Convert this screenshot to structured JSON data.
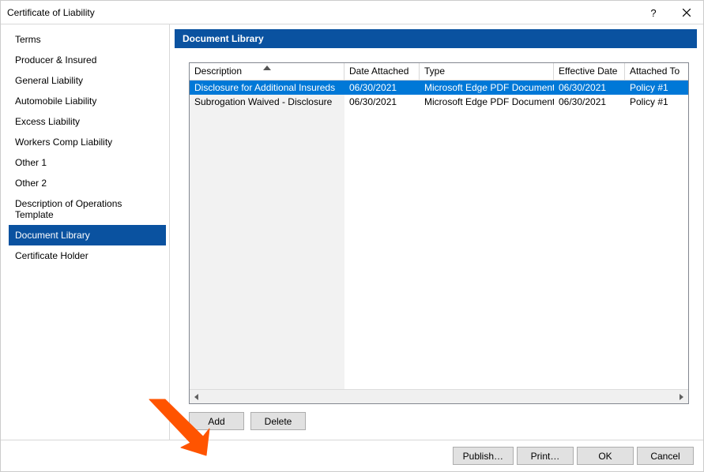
{
  "window": {
    "title": "Certificate of Liability"
  },
  "sidebar": {
    "items": [
      "Terms",
      "Producer & Insured",
      "General Liability",
      "Automobile Liability",
      "Excess Liability",
      "Workers Comp Liability",
      "Other 1",
      "Other 2",
      "Description of Operations Template",
      "Document Library",
      "Certificate Holder"
    ],
    "selected_index": 9
  },
  "section": {
    "title": "Document Library"
  },
  "table": {
    "columns": [
      "Description",
      "Date Attached",
      "Type",
      "Effective Date",
      "Attached To"
    ],
    "sort_column_index": 0,
    "sort_direction": "asc",
    "rows": [
      {
        "description": "Disclosure for Additional Insureds",
        "date_attached": "06/30/2021",
        "type": "Microsoft Edge PDF Document",
        "effective_date": "06/30/2021",
        "attached_to": "Policy #1",
        "selected": true
      },
      {
        "description": "Subrogation Waived - Disclosure",
        "date_attached": "06/30/2021",
        "type": "Microsoft Edge PDF Document",
        "effective_date": "06/30/2021",
        "attached_to": "Policy #1",
        "selected": false
      }
    ]
  },
  "buttons": {
    "add": "Add",
    "delete": "Delete"
  },
  "footer": {
    "publish": "Publish…",
    "print": "Print…",
    "ok": "OK",
    "cancel": "Cancel"
  }
}
